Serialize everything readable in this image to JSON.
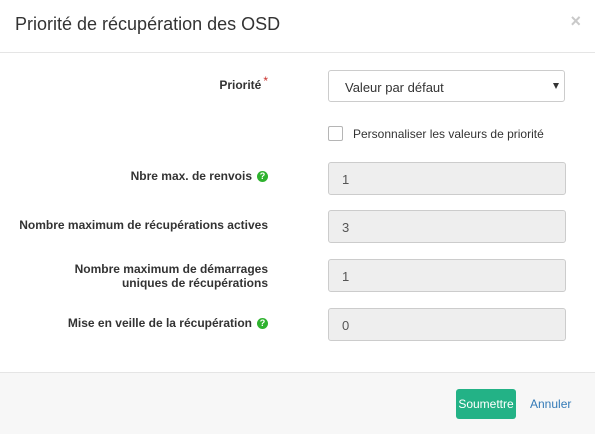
{
  "dialog": {
    "title": "Priorité de récupération des OSD",
    "close_symbol": "×"
  },
  "form": {
    "priority": {
      "label": "Priorité",
      "required_mark": "*",
      "selected": "Valeur par défaut"
    },
    "customize": {
      "label": "Personnaliser les valeurs de priorité",
      "checked": false
    },
    "fields": [
      {
        "label": "Nbre max. de renvois",
        "value": "1",
        "help_icon": "question-circle-icon"
      },
      {
        "label": "Nombre maximum de récupérations actives",
        "value": "3"
      },
      {
        "label_line1": "Nombre maximum de démarrages",
        "label_line2": "uniques de récupérations",
        "value": "1"
      },
      {
        "label": "Mise en veille de la récupération",
        "value": "0",
        "help_icon": "question-circle-icon"
      }
    ],
    "help_glyph": "?"
  },
  "footer": {
    "submit_label": "Soumettre",
    "cancel_label": "Annuler"
  },
  "colors": {
    "submit_bg": "#23b286",
    "link": "#337ab7",
    "help_icon": "#2eb22e",
    "required": "#c9302c"
  }
}
